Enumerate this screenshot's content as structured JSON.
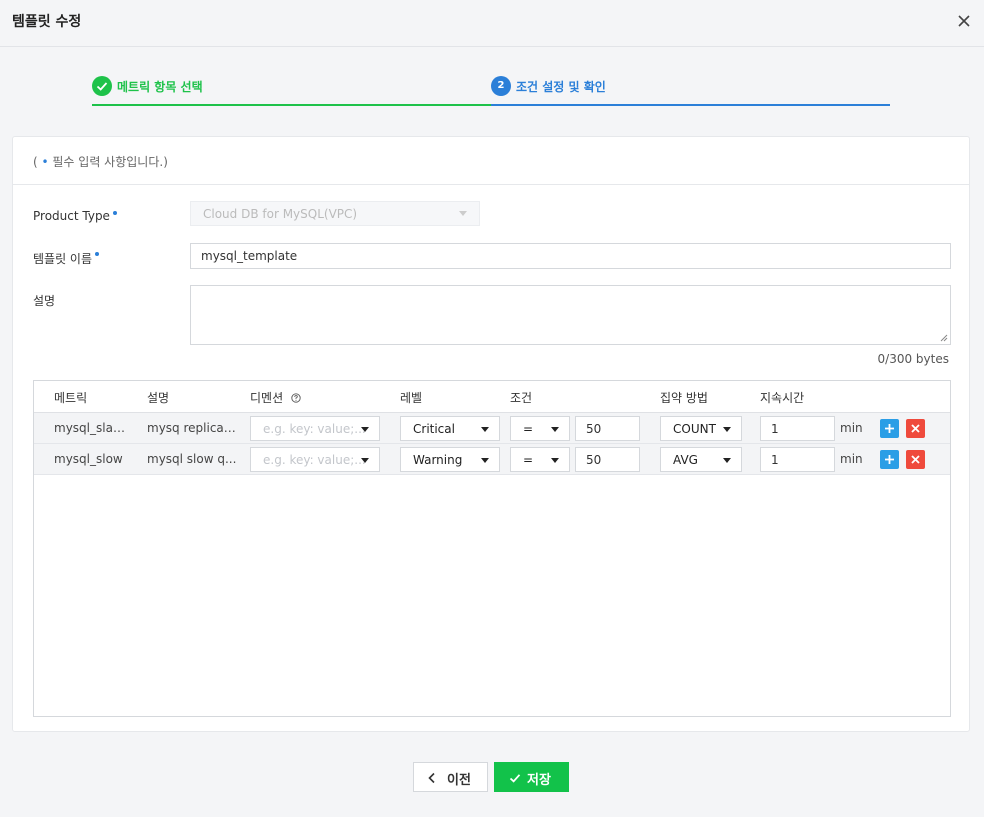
{
  "header": {
    "title": "템플릿 수정",
    "close_icon": "close-icon"
  },
  "steps": [
    {
      "label": "메트릭 항목 선택",
      "status": "complete",
      "color": "#1ec24a"
    },
    {
      "number": "2",
      "label": "조건 설정 및 확인",
      "status": "active",
      "color": "#2b7fd8"
    }
  ],
  "form": {
    "required_note_prefix": "( ",
    "required_note_dot": "•",
    "required_note_text": " 필수 입력 사항입니다.)",
    "product_type_label": "Product Type",
    "product_type_value": "Cloud DB for MySQL(VPC)",
    "template_name_label": "템플릿 이름",
    "template_name_value": "mysql_template",
    "description_label": "설명",
    "description_value": "",
    "byte_count": "0/300 bytes"
  },
  "table": {
    "headers": [
      "메트릭",
      "설명",
      "디멘션",
      "레벨",
      "조건",
      "집약 방법",
      "지속시간"
    ],
    "dimension_help_icon": "question-circle-icon",
    "rows": [
      {
        "metric": "mysql_slav...",
        "description": "mysq replicati...",
        "dimension_placeholder": "e.g. key: value;...",
        "level": "Critical",
        "operator": "=",
        "threshold": "50",
        "aggregation": "COUNT",
        "duration": "1",
        "unit": "min"
      },
      {
        "metric": "mysql_slow",
        "description": "mysql slow q...",
        "dimension_placeholder": "e.g. key: value;...",
        "level": "Warning",
        "operator": "=",
        "threshold": "50",
        "aggregation": "AVG",
        "duration": "1",
        "unit": "min"
      }
    ]
  },
  "footer": {
    "prev_label": "이전",
    "save_label": "저장"
  },
  "colors": {
    "green": "#12c24a",
    "blue": "#2b7fd8",
    "add": "#2a9ee6",
    "delete": "#ef4a3c"
  }
}
